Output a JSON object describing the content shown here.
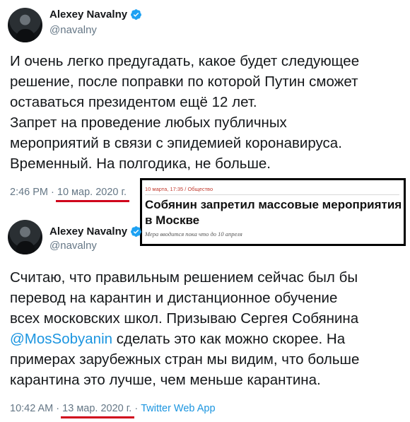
{
  "tweet1": {
    "name": "Alexey Navalny",
    "handle": "@navalny",
    "lines": [
      "И очень легко предугадать, какое будет следующее",
      "решение, после поправки по которой Путин сможет",
      "оставаться президентом ещё 12 лет.",
      "Запрет на проведение любых публичных",
      "мероприятий в связи с эпидемией коронавируса.",
      "Временный. На полгодика, не больше."
    ],
    "time": "2:46 PM",
    "sep": " · ",
    "date": "10 мар. 2020 г."
  },
  "clipping": {
    "kicker": "10 марта, 17:35 / Общество",
    "headline": "Собянин запретил массовые мероприятия в Москве",
    "lead": "Мера вводится пока что до 10 апреля"
  },
  "tweet2": {
    "name": "Alexey Navalny",
    "handle": "@navalny",
    "line1": "Считаю, что правильным решением сейчас был бы",
    "line2": "перевод на карантин и дистанционное обучение",
    "line3": "всех московских школ. Призываю Сергея Собянина",
    "mention": "@MosSobyanin",
    "line4_rest": " сделать это как можно скорее. На",
    "line5": "примерах зарубежных стран мы видим, что больше",
    "line6": "карантина это лучше, чем меньше карантина.",
    "time": "10:42 AM",
    "sep1": " · ",
    "date": "13 мар. 2020 г.",
    "sep2": " · ",
    "source": "Twitter Web App"
  },
  "colors": {
    "link": "#1b95e0",
    "muted": "#657786",
    "underline": "#d0021b",
    "verified": "#1da1f2"
  },
  "icons": {
    "verified": "verified-badge-icon"
  }
}
